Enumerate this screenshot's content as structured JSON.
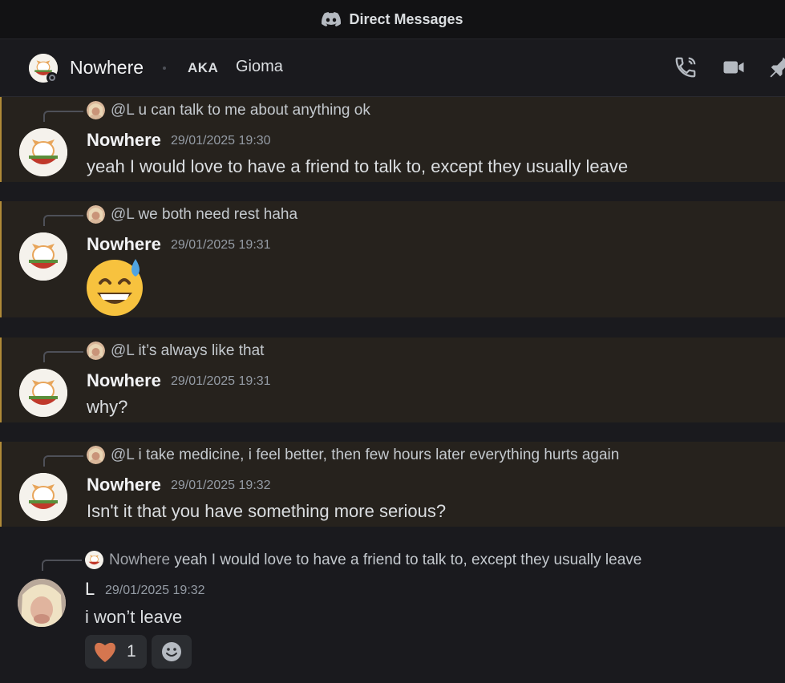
{
  "titlebar": {
    "title": "Direct Messages",
    "icon": "discord-logo-icon"
  },
  "header": {
    "name": "Nowhere",
    "aka_label": "AKA",
    "alias": "Gioma",
    "icons": [
      "voice-call-icon",
      "video-call-icon",
      "pin-icon"
    ]
  },
  "colors": {
    "highlight_bg": "#26221d",
    "highlight_border": "#b08a38",
    "background": "#1a1a1e"
  },
  "messages": [
    {
      "reply": {
        "mention": "@L",
        "text": "u can talk to me about anything ok"
      },
      "author": "Nowhere",
      "timestamp": "29/01/2025 19:30",
      "content": "yeah I would love to have a friend to talk to, except they usually leave"
    },
    {
      "reply": {
        "mention": "@L",
        "text": "we both need rest haha"
      },
      "author": "Nowhere",
      "timestamp": "29/01/2025 19:31",
      "content": "",
      "emoji": "grinning-face-with-sweat"
    },
    {
      "reply": {
        "mention": "@L",
        "text": "it’s always like that"
      },
      "author": "Nowhere",
      "timestamp": "29/01/2025 19:31",
      "content": "why?"
    },
    {
      "reply": {
        "mention": "@L",
        "text": "i take medicine, i feel better, then few hours later everything hurts again"
      },
      "author": "Nowhere",
      "timestamp": "29/01/2025 19:32",
      "content": "Isn't it that you have something more serious?"
    },
    {
      "reply": {
        "mention": "Nowhere",
        "text": "yeah I would love to have a friend to talk to, except they usually leave"
      },
      "author": "L",
      "timestamp": "29/01/2025 19:32",
      "content": "i won’t leave",
      "reactions": [
        {
          "emoji": "heart-icon",
          "count": "1"
        }
      ]
    }
  ]
}
